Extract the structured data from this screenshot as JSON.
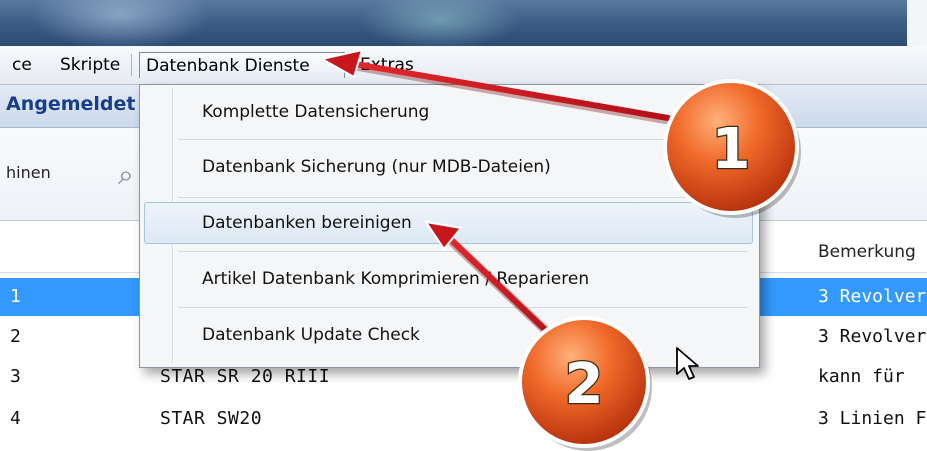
{
  "menubar": {
    "items": [
      {
        "label": "ce"
      },
      {
        "label": "Skripte"
      },
      {
        "label": "Datenbank Dienste"
      },
      {
        "label": "Extras"
      }
    ]
  },
  "infobar": {
    "text": "Angemeldet"
  },
  "toolbar": {
    "label": "hinen",
    "icon": "search-icon"
  },
  "table": {
    "header_note": "Bemerkung",
    "rows": [
      {
        "id": "1",
        "name": "",
        "note": "3 Revolver",
        "selected": true
      },
      {
        "id": "2",
        "name": "",
        "note": "3 Revolver",
        "selected": false
      },
      {
        "id": "3",
        "name": "STAR SR 20 RIII",
        "note": "kann für",
        "selected": false
      },
      {
        "id": "4",
        "name": "STAR SW20",
        "note": "3 Linien F",
        "selected": false
      }
    ]
  },
  "dropdown": {
    "items": [
      {
        "label": "Komplette Datensicherung"
      },
      {
        "label": "Datenbank Sicherung (nur MDB-Dateien)"
      },
      {
        "label": "Datenbanken bereinigen",
        "hovered": true
      },
      {
        "label": "Artikel Datenbank Komprimieren / Reparieren"
      },
      {
        "label": "Datenbank Update Check"
      }
    ]
  },
  "annotations": {
    "badge1": "1",
    "badge2": "2",
    "badge_color": "#e8501c",
    "arrow_color": "#c8171c"
  },
  "colors": {
    "selection": "#3399ff",
    "info_text": "#1a3d8a"
  }
}
